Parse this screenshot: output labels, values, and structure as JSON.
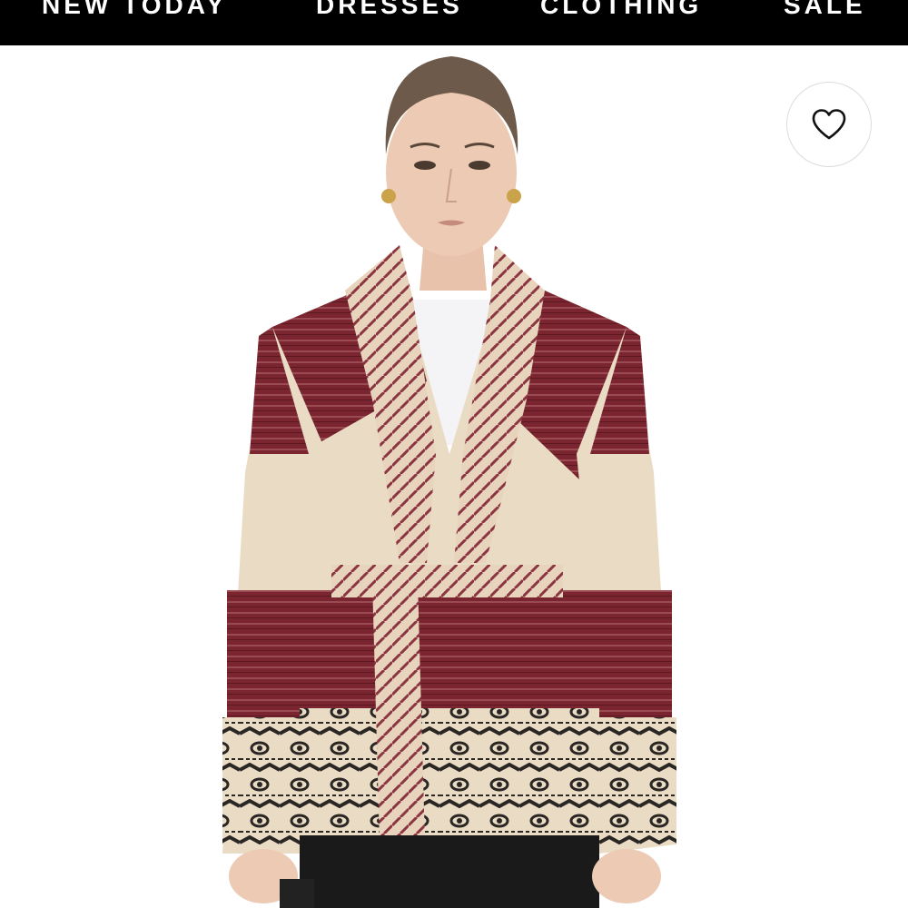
{
  "nav": {
    "items": [
      {
        "label": "NEW TODAY"
      },
      {
        "label": "DRESSES"
      },
      {
        "label": "CLOTHING"
      },
      {
        "label": "SALE"
      }
    ]
  },
  "product_image": {
    "icon": "product-photo-cardigan"
  },
  "wishlist": {
    "icon": "heart-icon"
  },
  "colors": {
    "nav_bg": "#000000",
    "nav_text": "#ffffff",
    "cream": "#eadcc4",
    "burgundy": "#7b2530",
    "pattern_black": "#2a2624"
  }
}
